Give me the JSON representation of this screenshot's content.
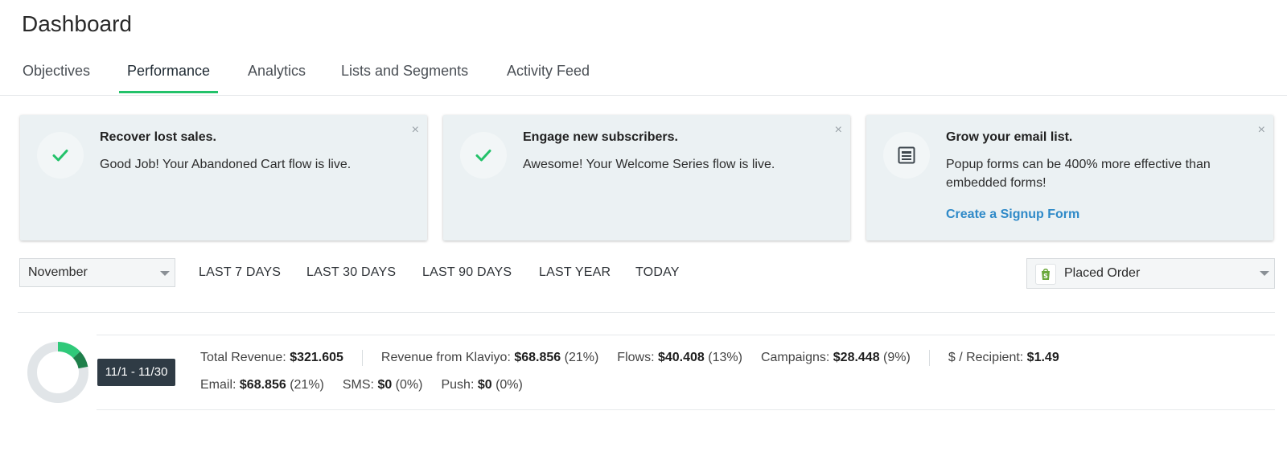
{
  "header": {
    "title": "Dashboard"
  },
  "tabs": [
    {
      "label": "Objectives",
      "active": false
    },
    {
      "label": "Performance",
      "active": true
    },
    {
      "label": "Analytics",
      "active": false
    },
    {
      "label": "Lists and Segments",
      "active": false
    },
    {
      "label": "Activity Feed",
      "active": false
    }
  ],
  "cards": [
    {
      "icon": "check-icon",
      "title": "Recover lost sales.",
      "body": "Good Job! Your Abandoned Cart flow is live.",
      "close": "×"
    },
    {
      "icon": "check-icon",
      "title": "Engage new subscribers.",
      "body": "Awesome! Your Welcome Series flow is live.",
      "close": "×"
    },
    {
      "icon": "form-icon",
      "title": "Grow your email list.",
      "body": "Popup forms can be 400% more effective than embedded forms!",
      "link": "Create a Signup Form",
      "close": "×"
    }
  ],
  "filters": {
    "month": "November",
    "ranges": [
      "LAST 7 DAYS",
      "LAST 30 DAYS",
      "LAST 90 DAYS",
      "LAST YEAR",
      "TODAY"
    ],
    "metric": "Placed Order"
  },
  "summary": {
    "date_range": "11/1 - 11/30",
    "row1": [
      {
        "label": "Total Revenue: ",
        "value": "$321.605",
        "pct": ""
      },
      {
        "label": "Revenue from Klaviyo: ",
        "value": "$68.856",
        "pct": " (21%)"
      },
      {
        "label": "Flows: ",
        "value": "$40.408",
        "pct": " (13%)"
      },
      {
        "label": "Campaigns: ",
        "value": "$28.448",
        "pct": " (9%)"
      },
      {
        "label": "$ / Recipient: ",
        "value": "$1.49",
        "pct": ""
      }
    ],
    "row2": [
      {
        "label": "Email: ",
        "value": "$68.856",
        "pct": " (21%)"
      },
      {
        "label": "SMS: ",
        "value": "$0",
        "pct": " (0%)"
      },
      {
        "label": "Push: ",
        "value": "$0",
        "pct": " (0%)"
      }
    ],
    "donut": {
      "flows_share": 0.13,
      "campaigns_share": 0.09
    }
  },
  "colors": {
    "accent": "#23c26a",
    "card_bg": "#ebf1f3",
    "link": "#2f8ac8",
    "badge_dark": "#2f3b45",
    "donut_track": "#e1e5e8",
    "donut_flows": "#2fc979",
    "donut_campaigns": "#1e7f4a"
  }
}
